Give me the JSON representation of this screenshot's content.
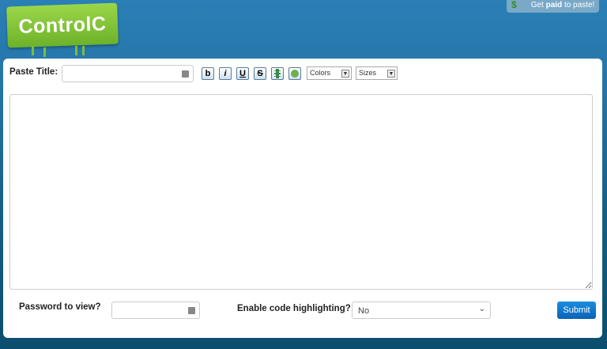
{
  "logo": {
    "text": "ControlC"
  },
  "promo": {
    "prefix": "Get",
    "bold": "paid",
    "suffix": "to paste!",
    "icon": "dollar-icon"
  },
  "form": {
    "title_label": "Paste Title:",
    "title_value": "",
    "toolbar": [
      {
        "name": "bold",
        "glyph": "b"
      },
      {
        "name": "italic",
        "glyph": "i"
      },
      {
        "name": "underline",
        "glyph": "U"
      },
      {
        "name": "strikethrough",
        "glyph": "S"
      },
      {
        "name": "film",
        "glyph": ""
      },
      {
        "name": "image",
        "glyph": ""
      }
    ],
    "colors_select": "Colors",
    "sizes_select": "Sizes",
    "content": "",
    "password_label": "Password to view?",
    "password_value": "",
    "highlight_label": "Enable code highlighting?",
    "highlight_value": "No",
    "submit_label": "Submit"
  }
}
